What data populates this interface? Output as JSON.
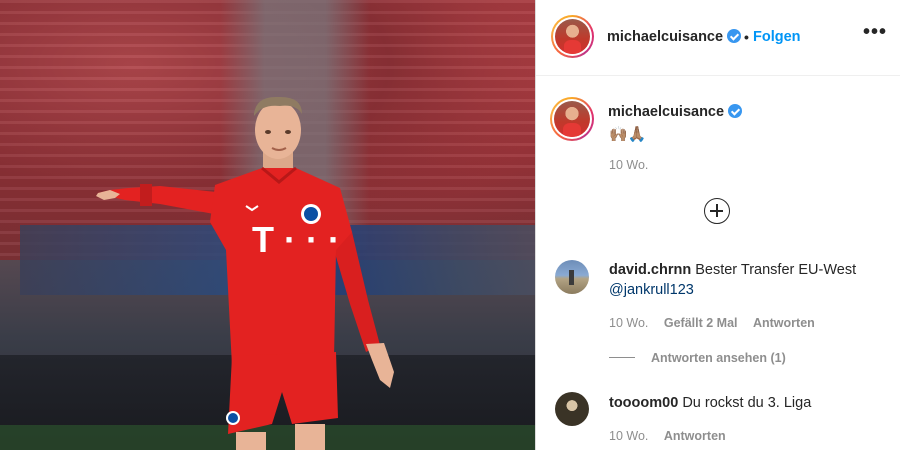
{
  "post": {
    "username": "michaelcuisance",
    "verified": true,
    "separator": "•",
    "follow_label": "Folgen",
    "more_icon": "more-options-icon",
    "photo": {
      "description_icon": "player-photo",
      "sponsor_text": "T · · ·"
    }
  },
  "caption": {
    "username": "michaelcuisance",
    "emojis": [
      "🙌🏽",
      "🙏🏽"
    ],
    "time": "10 Wo."
  },
  "load_more_icon": "plus-circle-icon",
  "comments": [
    {
      "username": "david.chrnn",
      "text": "Bester Transfer EU-West",
      "mention": "@jankrull123",
      "time": "10 Wo.",
      "likes": "Gefällt 2 Mal",
      "reply_label": "Antworten",
      "view_replies": "Antworten ansehen (1)"
    },
    {
      "username": "toooom00",
      "text": "Du rockst du 3. Liga",
      "time": "10 Wo.",
      "reply_label": "Antworten"
    }
  ],
  "colors": {
    "accent": "#0095f6",
    "verified": "#3897f0",
    "muted": "#8e8e8e",
    "text": "#262626",
    "jersey": "#e32221"
  }
}
